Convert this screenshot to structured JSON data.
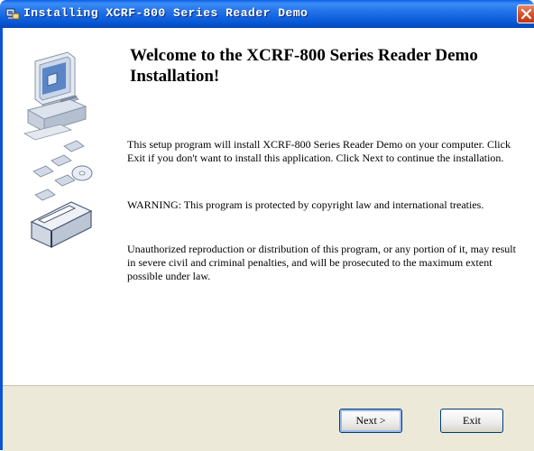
{
  "window": {
    "title": "Installing XCRF-800 Series Reader Demo"
  },
  "main": {
    "heading": "Welcome to the XCRF-800 Series Reader Demo Installation!",
    "paragraphs": [
      "This setup program will install XCRF-800 Series Reader Demo on your computer. Click Exit if you don't want to install this application. Click Next to continue the installation.",
      "WARNING: This program is protected by copyright law and international treaties.",
      "Unauthorized reproduction or distribution of this program, or any portion of it, may result in severe civil and criminal penalties, and will be prosecuted to the maximum extent possible under law."
    ]
  },
  "buttons": {
    "next": "Next >",
    "exit": "Exit"
  },
  "icons": {
    "app": "installer-app-icon",
    "close": "close-icon",
    "illustration": "computer-disks-box-illustration"
  },
  "colors": {
    "titlebar": "#0a5ee6",
    "close_button": "#d6522b",
    "footer": "#ece9d8"
  }
}
